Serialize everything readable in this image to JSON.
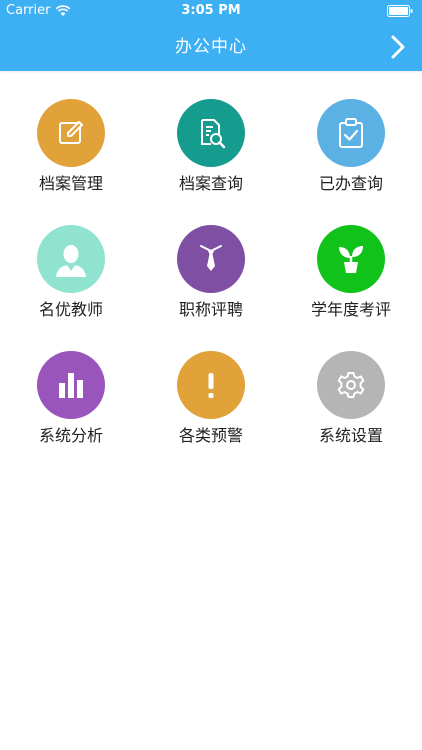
{
  "status_bar": {
    "carrier": "Carrier",
    "time": "3:05 PM"
  },
  "header": {
    "title": "办公中心",
    "forward_icon": "chevron-right-icon",
    "background": "#3cb0f2"
  },
  "menu": {
    "items": [
      {
        "label": "档案管理",
        "icon": "edit-icon",
        "color": "#e2a23a"
      },
      {
        "label": "档案查询",
        "icon": "document-search-icon",
        "color": "#169c8e"
      },
      {
        "label": "已办查询",
        "icon": "clipboard-check-icon",
        "color": "#5bb0e4"
      },
      {
        "label": "名优教师",
        "icon": "person-icon",
        "color": "#8fe3cf"
      },
      {
        "label": "职称评聘",
        "icon": "tie-icon",
        "color": "#7e4fa3"
      },
      {
        "label": "学年度考评",
        "icon": "sprout-icon",
        "color": "#10c21a"
      },
      {
        "label": "系统分析",
        "icon": "bar-chart-icon",
        "color": "#9955bb"
      },
      {
        "label": "各类预警",
        "icon": "exclamation-icon",
        "color": "#e2a23a"
      },
      {
        "label": "系统设置",
        "icon": "gear-icon",
        "color": "#b5b5b5"
      }
    ]
  }
}
